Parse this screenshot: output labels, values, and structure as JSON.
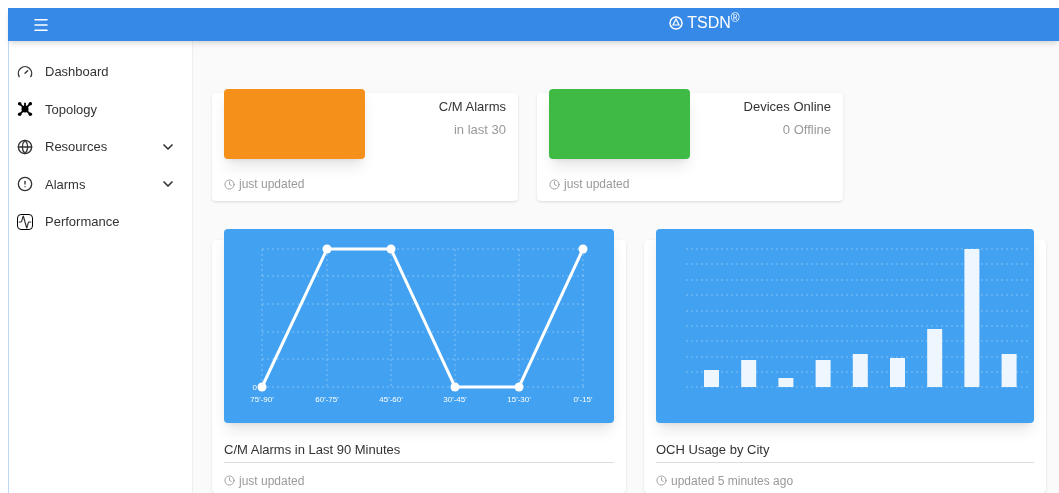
{
  "header": {
    "brand": "TSDN$^{®}$"
  },
  "sidebar": {
    "items": [
      {
        "label": "Dashboard",
        "expandable": false
      },
      {
        "label": "Topology",
        "expandable": false
      },
      {
        "label": "Resources",
        "expandable": true
      },
      {
        "label": "Alarms",
        "expandable": true
      },
      {
        "label": "Performance",
        "expandable": false
      }
    ]
  },
  "stat_cards": [
    {
      "kind": "alarms",
      "title": "C/M Alarms",
      "subtitle": "in last 30",
      "footer": "just updated"
    },
    {
      "kind": "devices",
      "title": "Devices Online",
      "subtitle": "0 Offline",
      "footer": "just updated"
    }
  ],
  "chart_cards": [
    {
      "kind": "line",
      "title": "C/M Alarms in Last 90 Minutes",
      "footer": "just updated",
      "y_label": "0",
      "x_labels": [
        "75'-90'",
        "60'-75'",
        "45'-60'",
        "30'-45'",
        "15'-30'",
        "0'-15'"
      ]
    },
    {
      "kind": "bar",
      "title": "OCH Usage by City",
      "footer": "updated 5 minutes ago"
    }
  ]
}
